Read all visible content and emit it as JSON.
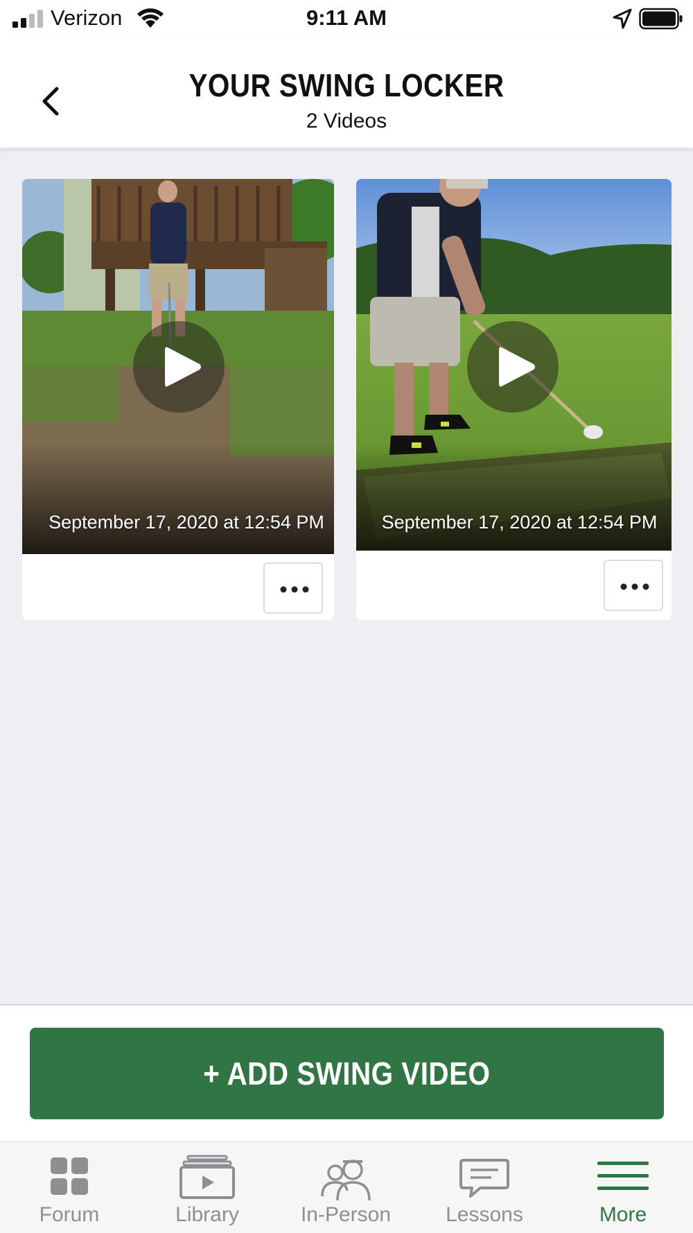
{
  "status_bar": {
    "carrier": "Verizon",
    "time": "9:11 AM"
  },
  "header": {
    "title": "YOUR SWING LOCKER",
    "subtitle": "2 Videos"
  },
  "videos": [
    {
      "date": "September 17, 2020 at 12:54 PM"
    },
    {
      "date": "September 17, 2020 at 12:54 PM"
    }
  ],
  "actions": {
    "add_video_label": "+ ADD SWING VIDEO"
  },
  "tab_bar": {
    "items": [
      {
        "label": "Forum",
        "icon": "grid-icon",
        "active": false
      },
      {
        "label": "Library",
        "icon": "video-library-icon",
        "active": false
      },
      {
        "label": "In-Person",
        "icon": "people-icon",
        "active": false
      },
      {
        "label": "Lessons",
        "icon": "chat-bubble-icon",
        "active": false
      },
      {
        "label": "More",
        "icon": "menu-icon",
        "active": true
      }
    ]
  },
  "colors": {
    "accent_green": "#327544",
    "inactive_gray": "#8e8e93",
    "background": "#efeef3"
  }
}
